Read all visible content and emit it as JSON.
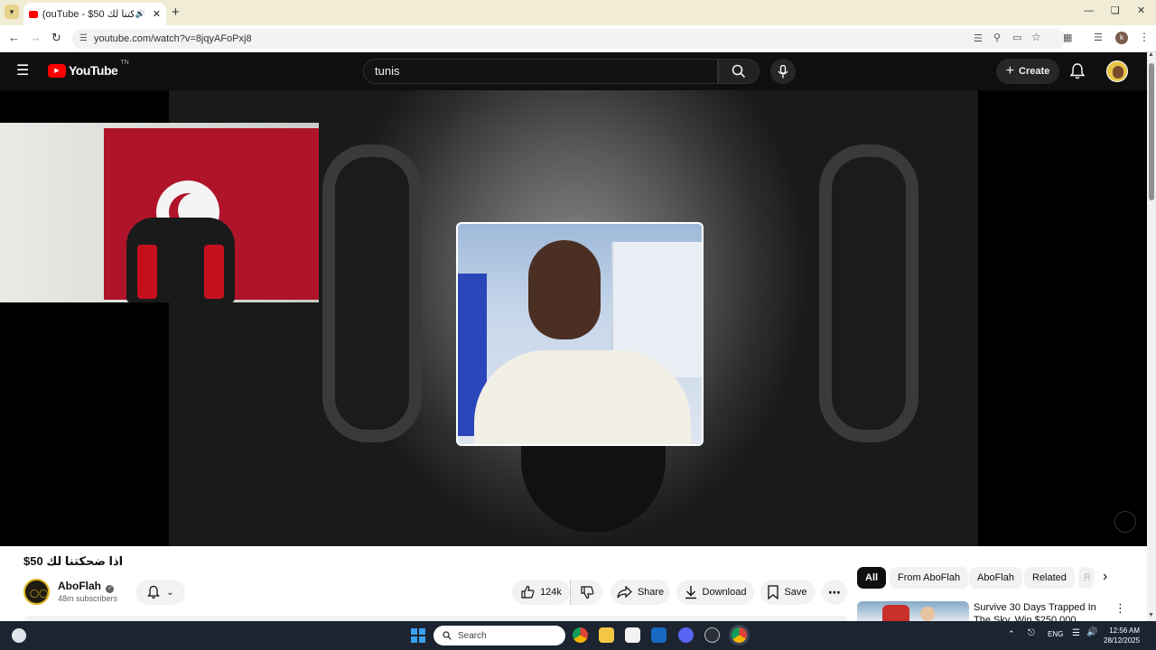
{
  "browser": {
    "tab_title": "(ouTube - $50 اذا ضحكتنا لك",
    "url": "youtube.com/watch?v=8jqyAFoPxj8"
  },
  "header": {
    "logo_text": "YouTube",
    "region": "TN",
    "search_value": "tunis",
    "create_label": "Create"
  },
  "video": {
    "title": "$اذا ضحكتنا لك 50",
    "channel_name": "AboFlah",
    "subscribers": "48m subscribers",
    "likes": "124k",
    "share_label": "Share",
    "download_label": "Download",
    "save_label": "Save"
  },
  "chips": [
    "All",
    "From AboFlah",
    "AboFlah",
    "Related",
    "R"
  ],
  "recommendation": {
    "title": "Survive 30 Days Trapped In The Sky, Win $250,000"
  },
  "taskbar": {
    "search_placeholder": "Search",
    "language": "ENG",
    "time": "12:56 AM",
    "date": "28/12/2025"
  },
  "colors": {
    "youtube_red": "#ff0000",
    "dark_bg": "#0f0f0f",
    "flag_red": "#b0142a"
  }
}
